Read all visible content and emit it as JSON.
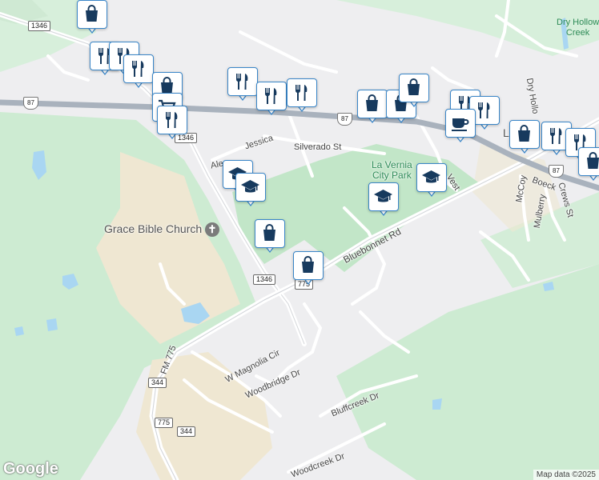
{
  "map": {
    "colors": {
      "background": "#eeeef0",
      "green": "#cdebd2",
      "park": "#c2e6c8",
      "tan": "#efe7d2",
      "water": "#a9d6f2",
      "highway": "#a9b2bd",
      "pin_border": "#3a86c8",
      "pin_icon": "#173a5e"
    },
    "place_labels": {
      "grace_bible_church": "Grace Bible Church",
      "la_vernia_city_park": "La Vernia\nCity Park",
      "dry_hollow_creek": "Dry Hollow\nCreek",
      "city_initial": "L"
    },
    "road_labels": {
      "bluebonnet_rd": "Bluebonnet Rd",
      "silverado_st": "Silverado St",
      "jessica": "Jessica",
      "ale": "Ale",
      "vest": "Vest",
      "fm_775": "FM 775",
      "w_magnolia_cir": "W Magnolia Cir",
      "woodbridge_dr": "Woodbridge Dr",
      "bluffcreek_dr": "Bluffcreek Dr",
      "woodcreek_dr": "Woodcreek Dr",
      "dry_hollow": "Dry Hollo",
      "mccoy": "McCoy",
      "boeck": "Boeck",
      "mulberry": "Mulberry",
      "crews_st": "Crews St"
    },
    "shields": {
      "r1346_top": "1346",
      "r1346_mid": "1346",
      "r1346_low": "1346",
      "r775_a": "775",
      "r344_a": "344",
      "r775_b": "775",
      "r344_b": "344",
      "us87_left": "87",
      "us87_center": "87",
      "us87_right": "87"
    },
    "pins": [
      {
        "id": "shopping-1",
        "icon": "shopping-bag-icon"
      },
      {
        "id": "restaurant-1",
        "icon": "restaurant-icon"
      },
      {
        "id": "restaurant-2",
        "icon": "restaurant-icon"
      },
      {
        "id": "restaurant-3",
        "icon": "restaurant-icon"
      },
      {
        "id": "shopping-2",
        "icon": "shopping-bag-icon"
      },
      {
        "id": "shopping-cart-1",
        "icon": "shopping-cart-icon"
      },
      {
        "id": "restaurant-4",
        "icon": "restaurant-icon"
      },
      {
        "id": "restaurant-5",
        "icon": "restaurant-icon"
      },
      {
        "id": "restaurant-6",
        "icon": "restaurant-icon"
      },
      {
        "id": "restaurant-7",
        "icon": "restaurant-icon"
      },
      {
        "id": "shopping-3",
        "icon": "shopping-bag-icon"
      },
      {
        "id": "shopping-4",
        "icon": "shopping-bag-icon"
      },
      {
        "id": "shopping-5",
        "icon": "shopping-bag-icon"
      },
      {
        "id": "restaurant-8",
        "icon": "restaurant-icon"
      },
      {
        "id": "restaurant-9",
        "icon": "restaurant-icon"
      },
      {
        "id": "cafe-1",
        "icon": "cafe-icon"
      },
      {
        "id": "shopping-6",
        "icon": "shopping-bag-icon"
      },
      {
        "id": "restaurant-10",
        "icon": "restaurant-icon"
      },
      {
        "id": "restaurant-11",
        "icon": "restaurant-icon"
      },
      {
        "id": "shopping-7",
        "icon": "shopping-bag-icon"
      },
      {
        "id": "school-1",
        "icon": "school-icon"
      },
      {
        "id": "school-2",
        "icon": "school-icon"
      },
      {
        "id": "school-3",
        "icon": "school-icon"
      },
      {
        "id": "school-4",
        "icon": "school-icon"
      },
      {
        "id": "shopping-8",
        "icon": "shopping-bag-icon"
      },
      {
        "id": "shopping-9",
        "icon": "shopping-bag-icon"
      }
    ],
    "google_logo": "Google",
    "attribution": "Map data ©2025"
  }
}
